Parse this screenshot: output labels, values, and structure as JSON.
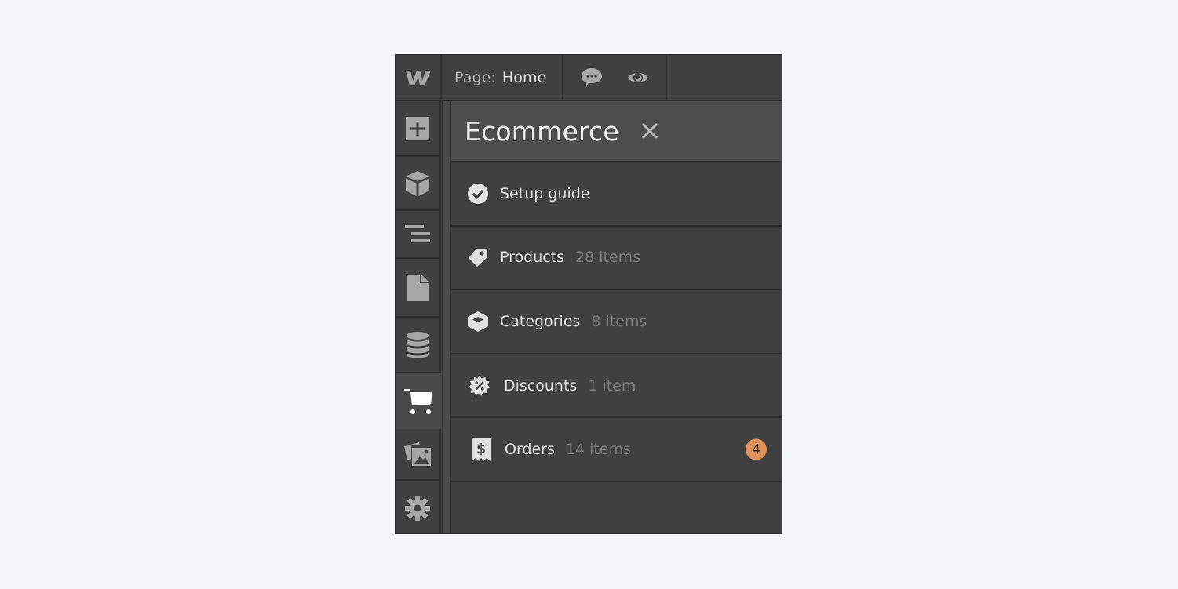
{
  "topbar": {
    "logo": "W",
    "page_label": "Page:",
    "page_value": "Home",
    "icons": [
      "comments-icon",
      "preview-eye-icon"
    ]
  },
  "sidebar": {
    "items": [
      {
        "name": "add-elements",
        "icon": "plus-icon",
        "active": false
      },
      {
        "name": "symbols",
        "icon": "cube-icon",
        "active": false
      },
      {
        "name": "navigator",
        "icon": "navigator-icon",
        "active": false
      },
      {
        "name": "pages",
        "icon": "page-icon",
        "active": false
      },
      {
        "name": "cms",
        "icon": "database-icon",
        "active": false
      },
      {
        "name": "ecommerce",
        "icon": "cart-icon",
        "active": true
      },
      {
        "name": "assets",
        "icon": "images-icon",
        "active": false
      },
      {
        "name": "settings",
        "icon": "gear-icon",
        "active": false
      }
    ]
  },
  "panel": {
    "title": "Ecommerce",
    "close_icon": "close-icon",
    "rows": [
      {
        "icon": "check-circle-icon",
        "label": "Setup guide",
        "count": ""
      },
      {
        "icon": "tag-icon",
        "label": "Products",
        "count": "28 items"
      },
      {
        "icon": "box-icon",
        "label": "Categories",
        "count": "8 items"
      },
      {
        "icon": "discount-badge-icon",
        "label": "Discounts",
        "count": "1 item"
      },
      {
        "icon": "receipt-icon",
        "label": "Orders",
        "count": "14 items",
        "badge": "4"
      }
    ]
  },
  "colors": {
    "background": "#f5f6f8",
    "panel": "#404040",
    "header": "#4d4d4d",
    "badge": "#e0935a",
    "muted_text": "#7c7c7c"
  }
}
